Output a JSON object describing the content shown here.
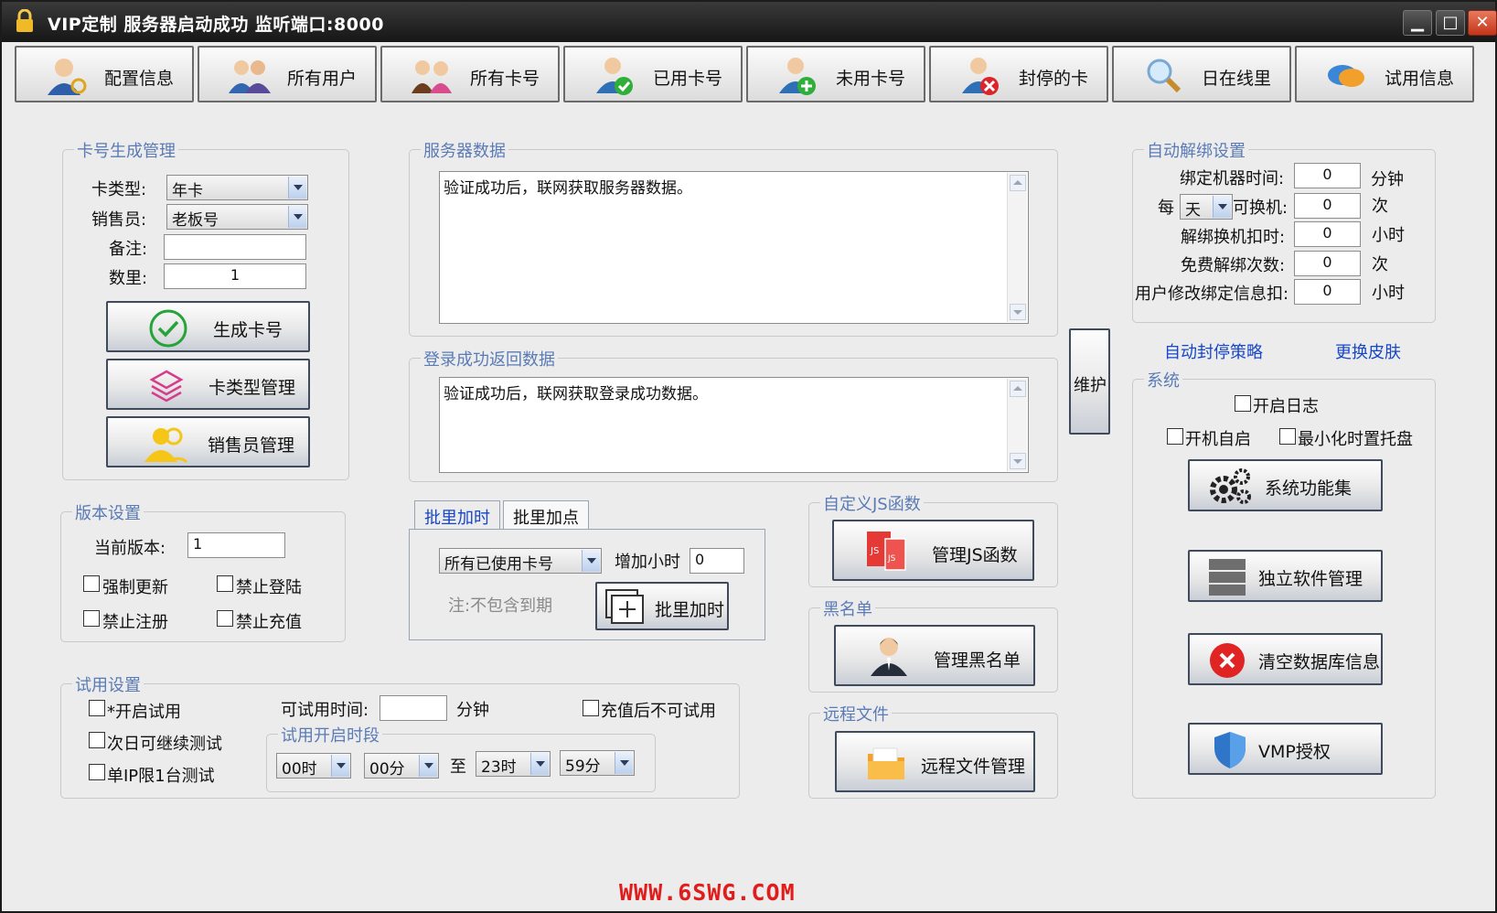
{
  "window": {
    "title": "VIP定制  服务器启动成功  监听端口:8000",
    "minimize": "▁",
    "maximize": "□",
    "close": "✕"
  },
  "toolbar": {
    "buttons": [
      {
        "label": "配置信息",
        "icon": "user-key-icon"
      },
      {
        "label": "所有用户",
        "icon": "users-group-icon"
      },
      {
        "label": "所有卡号",
        "icon": "users-family-icon"
      },
      {
        "label": "已用卡号",
        "icon": "user-check-icon"
      },
      {
        "label": "未用卡号",
        "icon": "user-add-icon"
      },
      {
        "label": "封停的卡",
        "icon": "user-block-icon"
      },
      {
        "label": "日在线里",
        "icon": "magnifier-icon"
      },
      {
        "label": "试用信息",
        "icon": "chat-bubble-icon"
      }
    ]
  },
  "card_gen": {
    "legend": "卡号生成管理",
    "type_label": "卡类型:",
    "type_value": "年卡",
    "seller_label": "销售员:",
    "seller_value": "老板号",
    "note_label": "备注:",
    "note_value": "",
    "qty_label": "数里:",
    "qty_value": "1",
    "btn_generate": "生成卡号",
    "btn_type_mgmt": "卡类型管理",
    "btn_seller_mgmt": "销售员管理"
  },
  "version": {
    "legend": "版本设置",
    "current_label": "当前版本:",
    "current_value": "1",
    "force_update": "强制更新",
    "ban_login": "禁止登陆",
    "ban_register": "禁止注册",
    "ban_recharge": "禁止充值"
  },
  "trial": {
    "legend": "试用设置",
    "enable": "*开启试用",
    "next_day": "次日可继续测试",
    "single_ip": "单IP限1台测试",
    "time_label": "可试用时间:",
    "time_value": "",
    "time_unit": "分钟",
    "no_trial_after_recharge": "充值后不可试用",
    "period_legend": "试用开启时段",
    "start_hour": "00时",
    "start_min": "00分",
    "to": "至",
    "end_hour": "23时",
    "end_min": "59分"
  },
  "server_data": {
    "legend": "服务器数据",
    "text": "验证成功后，联网获取服务器数据。"
  },
  "login_return": {
    "legend": "登录成功返回数据",
    "text": "验证成功后，联网获取登录成功数据。"
  },
  "batch": {
    "tab_time": "批里加时",
    "tab_points": "批里加点",
    "scope_value": "所有已使用卡号",
    "add_hours_label": "增加小时",
    "add_hours_value": "0",
    "note": "注:不包含到期",
    "btn_add": "批里加时"
  },
  "maintain": {
    "label": "维护"
  },
  "js": {
    "legend": "自定义JS函数",
    "btn": "管理JS函数"
  },
  "blacklist": {
    "legend": "黑名单",
    "btn": "管理黑名单"
  },
  "remote": {
    "legend": "远程文件",
    "btn": "远程文件管理"
  },
  "unbind": {
    "legend": "自动解绑设置",
    "bind_time_label": "绑定机器时间:",
    "bind_time_value": "0",
    "bind_time_unit": "分钟",
    "per_label": "每",
    "per_value": "天",
    "switch_label": "可换机:",
    "switch_value": "0",
    "switch_unit": "次",
    "deduct_label": "解绑换机扣时:",
    "deduct_value": "0",
    "deduct_unit": "小时",
    "free_label": "免费解绑次数:",
    "free_value": "0",
    "free_unit": "次",
    "modify_label": "用户修改绑定信息扣:",
    "modify_value": "0",
    "modify_unit": "小时"
  },
  "links": {
    "auto_ban": "自动封停策略",
    "change_skin": "更换皮肤"
  },
  "system": {
    "legend": "系统",
    "enable_log": "开启日志",
    "autostart": "开机自启",
    "minimize_tray": "最小化时置托盘",
    "btn_functions": "系统功能集",
    "btn_software": "独立软件管理",
    "btn_clear_db": "清空数据库信息",
    "btn_vmp": "VMP授权"
  },
  "watermark": "WWW.6SWG.COM"
}
